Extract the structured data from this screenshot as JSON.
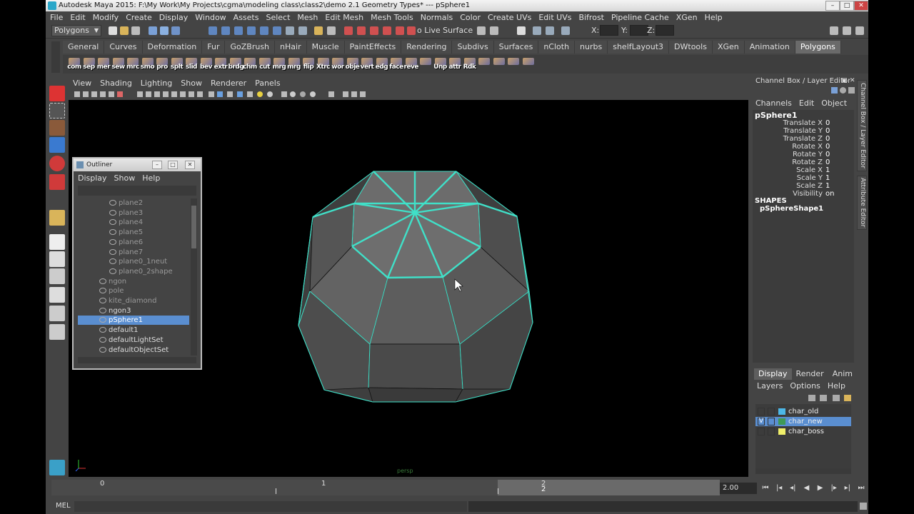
{
  "window": {
    "title": "Autodesk Maya 2015: F:\\My Work\\My Projects\\cgma\\modeling class\\class2\\demo 2.1 Geometry Types*   ---   pSphere1"
  },
  "menubar": [
    "File",
    "Edit",
    "Modify",
    "Create",
    "Display",
    "Window",
    "Assets",
    "Select",
    "Mesh",
    "Edit Mesh",
    "Mesh Tools",
    "Normals",
    "Color",
    "Create UVs",
    "Edit UVs",
    "Bifrost",
    "Pipeline Cache",
    "XGen",
    "Help"
  ],
  "statusline": {
    "mode": "Polygons",
    "live_surface": "o Live Surface",
    "x_label": "X:",
    "y_label": "Y:",
    "z_label": "Z:"
  },
  "shelf": {
    "tabs": [
      "General",
      "Curves",
      "Deformation",
      "Fur",
      "GoZBrush",
      "nHair",
      "Muscle",
      "PaintEffects",
      "Rendering",
      "Subdivs",
      "Surfaces",
      "nCloth",
      "nurbs",
      "shelfLayout3",
      "DWtools",
      "XGen",
      "Animation",
      "Polygons"
    ],
    "active_tab": "Polygons",
    "buttons": [
      "com",
      "sep",
      "mer",
      "sew",
      "mrc",
      "smo",
      "pro",
      "splt",
      "slid",
      "bev",
      "extr",
      "brdg",
      "chm",
      "cut",
      "mrg",
      "mrg",
      "flip",
      "Xtrc",
      "wor",
      "obje",
      "vert",
      "edg",
      "face",
      "reve",
      "",
      "Unp",
      "attr",
      "Rdk",
      "",
      "",
      "",
      ""
    ]
  },
  "viewport": {
    "menu": [
      "View",
      "Shading",
      "Lighting",
      "Show",
      "Renderer",
      "Panels"
    ],
    "camera_label": "persp"
  },
  "outliner": {
    "title": "Outliner",
    "menu": [
      "Display",
      "Show",
      "Help"
    ],
    "rows": [
      {
        "label": "plane2",
        "state": "dim",
        "indent": 2
      },
      {
        "label": "plane3",
        "state": "dim",
        "indent": 2
      },
      {
        "label": "plane4",
        "state": "dim",
        "indent": 2
      },
      {
        "label": "plane5",
        "state": "dim",
        "indent": 2
      },
      {
        "label": "plane6",
        "state": "dim",
        "indent": 2
      },
      {
        "label": "plane7",
        "state": "dim",
        "indent": 2
      },
      {
        "label": "plane0_1neut",
        "state": "dim",
        "indent": 2
      },
      {
        "label": "plane0_2shape",
        "state": "dim",
        "indent": 2
      },
      {
        "label": "ngon",
        "state": "dim",
        "indent": 1
      },
      {
        "label": "pole",
        "state": "dim",
        "indent": 1
      },
      {
        "label": "kite_diamond",
        "state": "dim",
        "indent": 1
      },
      {
        "label": "ngon3",
        "state": "normal",
        "indent": 1
      },
      {
        "label": "pSphere1",
        "state": "selected",
        "indent": 1
      },
      {
        "label": "default1",
        "state": "normal",
        "indent": 1
      },
      {
        "label": "defaultLightSet",
        "state": "normal",
        "indent": 1
      },
      {
        "label": "defaultObjectSet",
        "state": "normal",
        "indent": 1
      }
    ]
  },
  "channel_box": {
    "title": "Channel Box / Layer Editor",
    "menu": [
      "Channels",
      "Edit",
      "Object"
    ],
    "object": "pSphere1",
    "attributes": [
      {
        "name": "Translate X",
        "value": "0"
      },
      {
        "name": "Translate Y",
        "value": "0"
      },
      {
        "name": "Translate Z",
        "value": "0"
      },
      {
        "name": "Rotate X",
        "value": "0"
      },
      {
        "name": "Rotate Y",
        "value": "0"
      },
      {
        "name": "Rotate Z",
        "value": "0"
      },
      {
        "name": "Scale X",
        "value": "1"
      },
      {
        "name": "Scale Y",
        "value": "1"
      },
      {
        "name": "Scale Z",
        "value": "1"
      },
      {
        "name": "Visibility",
        "value": "on"
      }
    ],
    "shapes_label": "SHAPES",
    "shape_name": "pSphereShape1",
    "side_tabs": [
      "Channel Box / Layer Editor",
      "Attribute Editor"
    ]
  },
  "layer_editor": {
    "tabs": [
      "Display",
      "Render",
      "Anim"
    ],
    "active_tab": "Display",
    "menu": [
      "Layers",
      "Options",
      "Help"
    ],
    "layers": [
      {
        "name": "char_old",
        "color": "#4db8e8",
        "visible": "",
        "selected": false
      },
      {
        "name": "char_new",
        "color": "#3f9a56",
        "visible": "V",
        "selected": true
      },
      {
        "name": "char_boss",
        "color": "#f0ef6a",
        "visible": "",
        "selected": false
      }
    ]
  },
  "timeline": {
    "ticks": [
      "0",
      "1",
      "2"
    ],
    "current_frame": "2",
    "range_end": "2.00"
  },
  "command_line": {
    "label": "MEL"
  },
  "colors": {
    "wire_highlight": "#40e0c8",
    "selection": "#5a8ed0"
  }
}
